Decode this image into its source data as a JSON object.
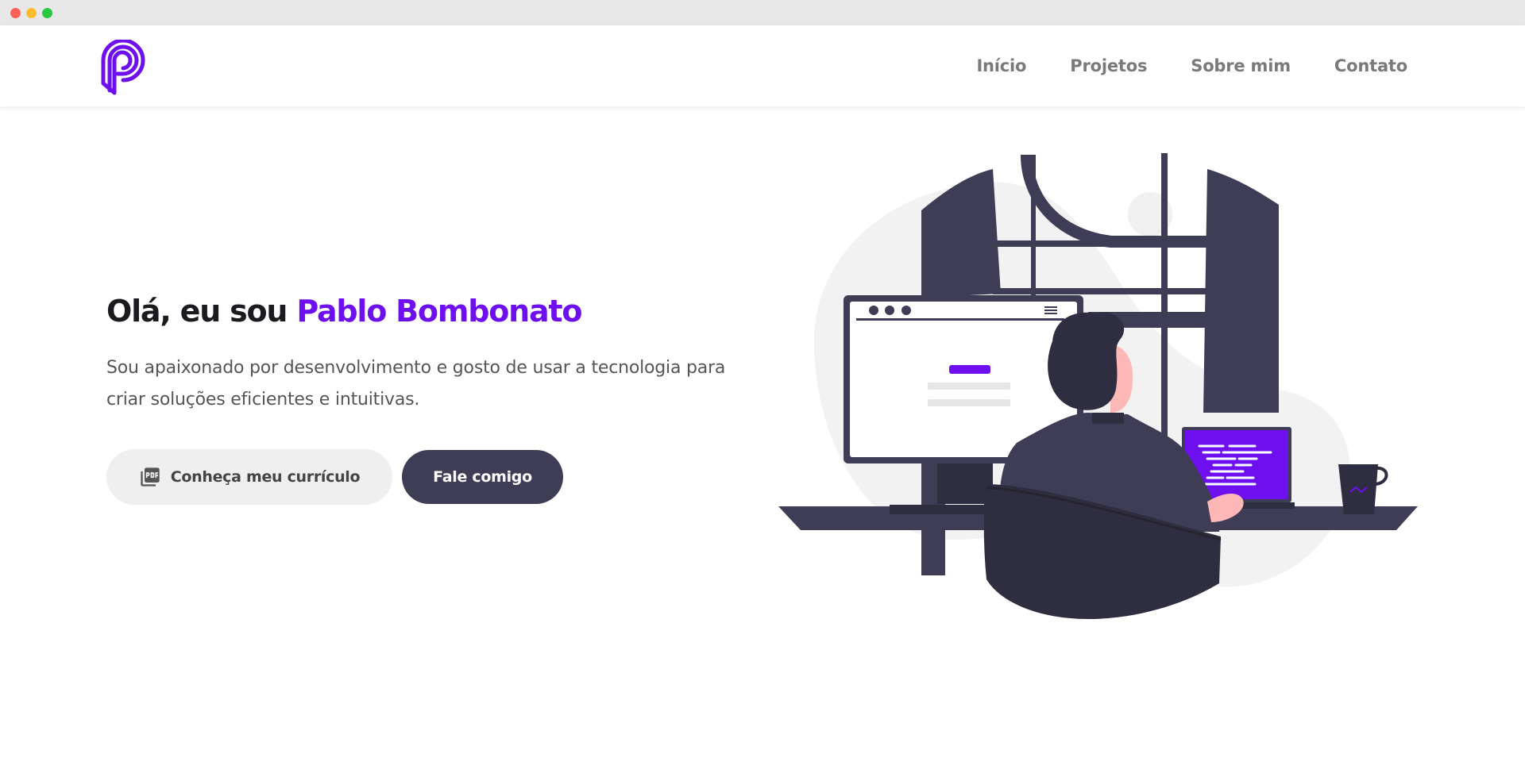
{
  "nav": {
    "items": [
      "Início",
      "Projetos",
      "Sobre mim",
      "Contato"
    ]
  },
  "hero": {
    "greeting": "Olá, eu sou ",
    "name": "Pablo Bombonato",
    "description": "Sou apaixonado por desenvolvimento e gosto de usar a tecnologia para criar soluções eficientes e intuitivas."
  },
  "buttons": {
    "cv_label": "Conheça meu currículo",
    "contact_label": "Fale comigo"
  },
  "icons": {
    "logo": "brand-logo",
    "cv": "pdf-icon"
  },
  "colors": {
    "accent": "#6e0ff0",
    "dark": "#3f3d56",
    "nav_text": "#7a7a7a"
  }
}
